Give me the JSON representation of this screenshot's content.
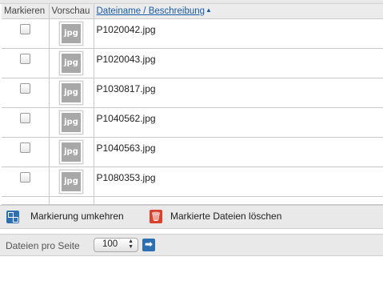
{
  "table": {
    "headers": {
      "select": "Markieren",
      "preview": "Vorschau",
      "name": "Dateiname / Beschreibung"
    },
    "sort_indicator": "▲",
    "thumb_label": "jpg",
    "rows": [
      {
        "file": "P1020042.jpg",
        "checked": false
      },
      {
        "file": "P1020043.jpg",
        "checked": false
      },
      {
        "file": "P1030817.jpg",
        "checked": false
      },
      {
        "file": "P1040562.jpg",
        "checked": false
      },
      {
        "file": "P1040563.jpg",
        "checked": false
      },
      {
        "file": "P1080353.jpg",
        "checked": false
      }
    ]
  },
  "actions": {
    "invert_label": "Markierung umkehren",
    "delete_label": "Markierte Dateien löschen"
  },
  "paging": {
    "label": "Dateien pro Seite",
    "per_page": "100",
    "go_symbol": "➡"
  },
  "icons": {
    "invert": "invert-selection-icon",
    "delete": "trash-icon",
    "go": "arrow-right-icon"
  },
  "colors": {
    "link": "#1a5aa6",
    "action_blue": "#2d6fb0",
    "delete_red": "#d9412c"
  }
}
